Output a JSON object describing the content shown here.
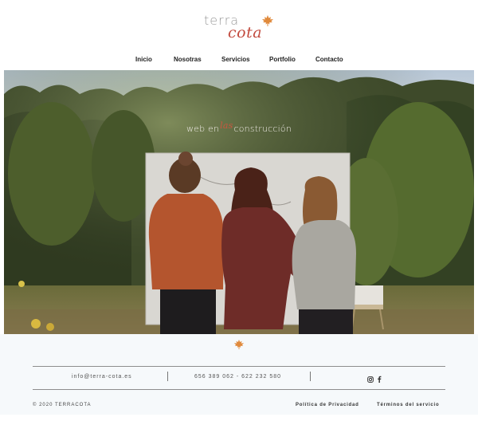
{
  "brand": {
    "word1": "terra",
    "word2": "cota",
    "leaf_color": "#e08a3c",
    "accent_color": "#c24a3e"
  },
  "nav": {
    "items": [
      {
        "label": "Inicio"
      },
      {
        "label": "Nosotras"
      },
      {
        "label": "Servicios"
      },
      {
        "label": "Portfolio"
      },
      {
        "label": "Contacto"
      }
    ]
  },
  "hero": {
    "text_before": "web en",
    "text_sep": "las",
    "text_after": "construcción"
  },
  "footer": {
    "email": "info@terra-cota.es",
    "phones": "656 389 062 - 622 232 580",
    "social": [
      {
        "icon": "instagram-icon"
      },
      {
        "icon": "facebook-icon"
      }
    ],
    "copyright": "© 2020 TERRACOTA",
    "privacy": "Política de Privacidad",
    "terms": "Términos del servicio"
  }
}
